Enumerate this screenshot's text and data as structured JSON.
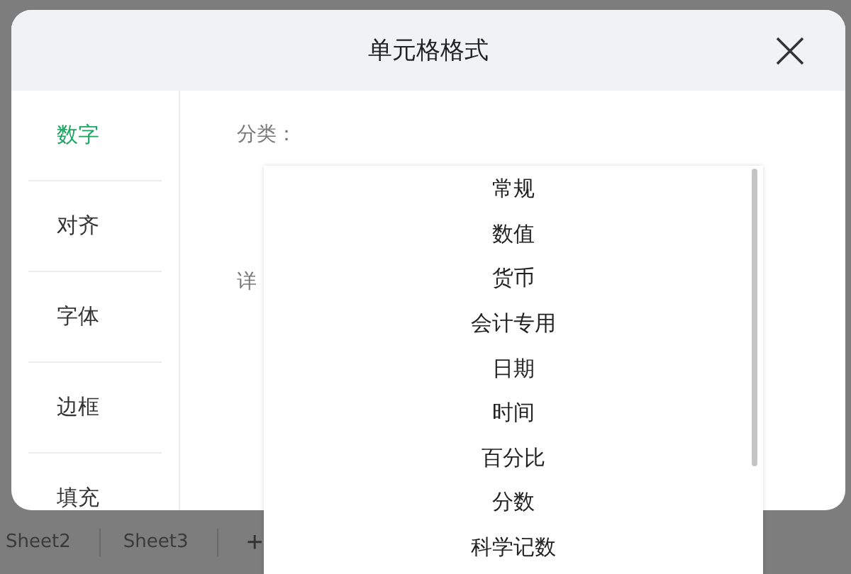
{
  "dialog": {
    "title": "单元格格式"
  },
  "sidebar": {
    "items": [
      {
        "label": "数字",
        "selected": true
      },
      {
        "label": "对齐",
        "selected": false
      },
      {
        "label": "字体",
        "selected": false
      },
      {
        "label": "边框",
        "selected": false
      },
      {
        "label": "填充",
        "selected": false
      }
    ]
  },
  "content": {
    "category_label": "分类：",
    "detail_label": "详"
  },
  "dropdown": {
    "options": [
      "常规",
      "数值",
      "货币",
      "会计专用",
      "日期",
      "时间",
      "百分比",
      "分数",
      "科学记数"
    ]
  },
  "sheet_tabs": [
    "Sheet2",
    "Sheet3"
  ],
  "add_sheet": "+"
}
